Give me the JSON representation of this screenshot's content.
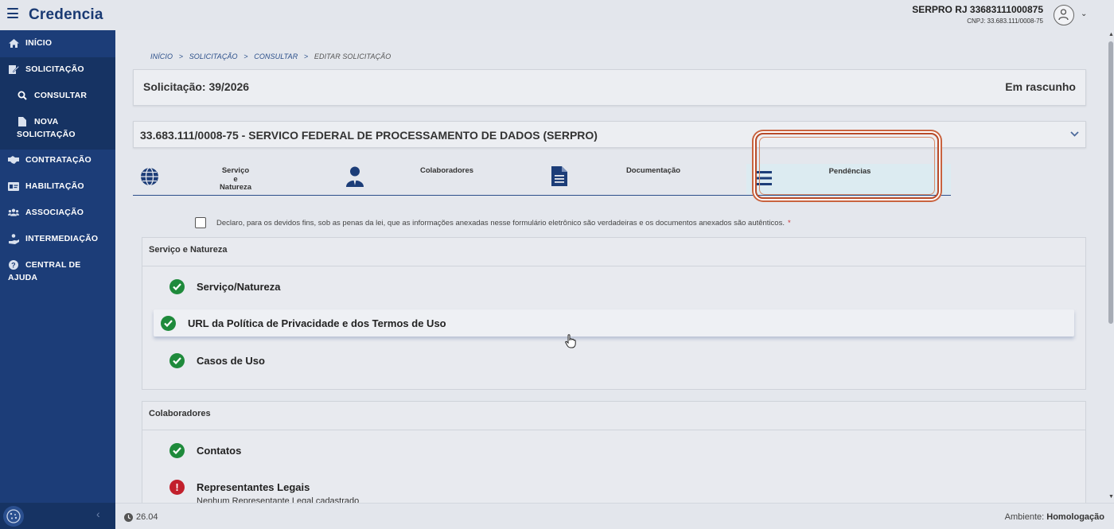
{
  "app": {
    "brand": "Credencia"
  },
  "user": {
    "name": "SERPRO RJ 33683111000875",
    "cnpj": "CNPJ: 33.683.111/0008-75"
  },
  "sidebar": {
    "items": [
      {
        "label": "INÍCIO",
        "icon": "home-icon"
      },
      {
        "label": "SOLICITAÇÃO",
        "icon": "edit-icon"
      },
      {
        "label": "CONSULTAR",
        "icon": "search-icon"
      },
      {
        "label_line1": "NOVA",
        "label_line2": "SOLICITAÇÃO",
        "icon": "file-icon"
      },
      {
        "label": "CONTRATAÇÃO",
        "icon": "handshake-icon"
      },
      {
        "label": "HABILITAÇÃO",
        "icon": "id-card-icon"
      },
      {
        "label": "ASSOCIAÇÃO",
        "icon": "users-icon"
      },
      {
        "label": "INTERMEDIAÇÃO",
        "icon": "hand-person-icon"
      },
      {
        "label_line1": "CENTRAL DE",
        "label_line2": "AJUDA",
        "icon": "help-icon"
      }
    ]
  },
  "breadcrumb": {
    "items": [
      "INÍCIO",
      "SOLICITAÇÃO",
      "CONSULTAR",
      "EDITAR SOLICITAÇÃO"
    ],
    "separator": ">"
  },
  "solicitacao": {
    "title": "Solicitação: 39/2026",
    "status": "Em rascunho"
  },
  "company": {
    "title": "33.683.111/0008-75 - SERVICO FEDERAL DE PROCESSAMENTO DE DADOS (SERPRO)"
  },
  "tabs": [
    {
      "line1": "Serviço",
      "line2": "e",
      "line3": "Natureza",
      "icon": "globe-icon"
    },
    {
      "label": "Colaboradores",
      "icon": "person-icon"
    },
    {
      "label": "Documentação",
      "icon": "document-icon"
    },
    {
      "label": "Pendências",
      "icon": "list-icon",
      "active": true
    }
  ],
  "declaration": {
    "text": "Declaro, para os devidos fins, sob as penas da lei, que as informações anexadas nesse formulário eletrônico são verdadeiras e os documentos anexados são autênticos.",
    "required_mark": "*"
  },
  "sections": [
    {
      "title": "Serviço e Natureza",
      "items": [
        {
          "label": "Serviço/Natureza",
          "status": "ok"
        },
        {
          "label": "URL da Política de Privacidade e dos Termos de Uso",
          "status": "ok"
        },
        {
          "label": "Casos de Uso",
          "status": "ok"
        }
      ]
    },
    {
      "title": "Colaboradores",
      "items": [
        {
          "label": "Contatos",
          "status": "ok"
        },
        {
          "label": "Representantes Legais",
          "status": "error",
          "sub": "Nenhum Representante Legal cadastrado"
        }
      ]
    }
  ],
  "footer": {
    "version": "26.04",
    "env_label": "Ambiente:",
    "env_value": "Homologação"
  },
  "colors": {
    "primary": "#1c3d78",
    "success": "#1e8a3b",
    "error": "#c2202c",
    "highlight": "#b84b2a"
  }
}
